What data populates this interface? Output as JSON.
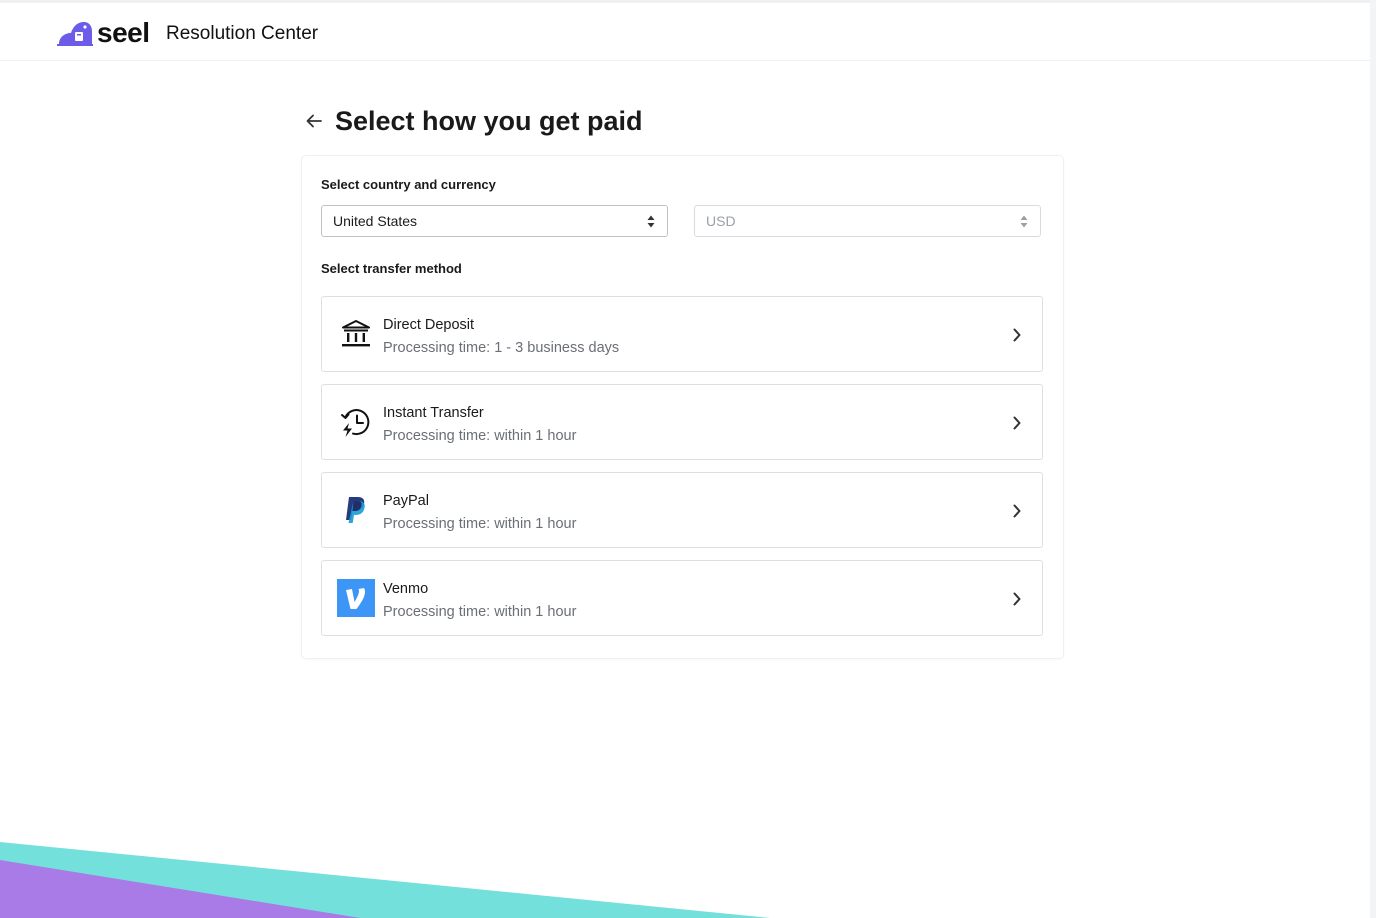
{
  "header": {
    "logo_text": "seel",
    "title": "Resolution Center"
  },
  "page": {
    "title": "Select how you get paid"
  },
  "form": {
    "country_currency_label": "Select country and currency",
    "country": {
      "selected": "United States"
    },
    "currency": {
      "selected": "USD"
    },
    "transfer_method_label": "Select transfer method"
  },
  "methods": [
    {
      "name": "Direct Deposit",
      "processing": "Processing time: 1 - 3 business days",
      "icon": "bank-icon"
    },
    {
      "name": "Instant Transfer",
      "processing": "Processing time: within 1 hour",
      "icon": "instant-transfer-icon"
    },
    {
      "name": "PayPal",
      "processing": "Processing time: within 1 hour",
      "icon": "paypal-icon"
    },
    {
      "name": "Venmo",
      "processing": "Processing time: within 1 hour",
      "icon": "venmo-icon"
    }
  ],
  "colors": {
    "brand_purple": "#6c5ce7",
    "teal": "#74e0dc",
    "purple": "#a97be6",
    "venmo_blue": "#3d95f5",
    "paypal_dark": "#253b80",
    "paypal_light": "#179bd7"
  }
}
